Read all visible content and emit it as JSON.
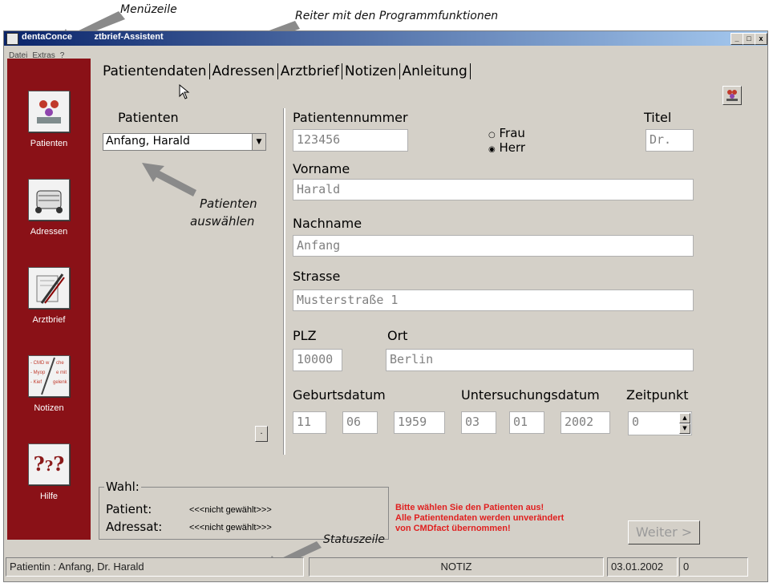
{
  "annotations": {
    "menuzeile": "Menüzeile",
    "reiter": "Reiter mit den Programmfunktionen",
    "patienten_line1": "Patienten",
    "patienten_line2": "auswählen",
    "statuszeile": "Statuszeile"
  },
  "window": {
    "title_left": "dentaConce",
    "title_right": "ztbrief-Assistent",
    "controls": [
      "_",
      "□",
      "x"
    ]
  },
  "menu": [
    "Datei",
    "Extras",
    "?"
  ],
  "sidebar": [
    {
      "label": "Patienten",
      "icon": "patients-icon"
    },
    {
      "label": "Adressen",
      "icon": "rolodex-icon"
    },
    {
      "label": "Arztbrief",
      "icon": "letter-pen-icon"
    },
    {
      "label": "Notizen",
      "icon": "notes-icon"
    },
    {
      "label": "Hilfe",
      "icon": "help-icon"
    }
  ],
  "sidebar_notes_text": [
    "- CMD w",
    "che",
    "- Myop",
    "e mit",
    "- Kief",
    "gelenk"
  ],
  "tabs": [
    "Patientendaten",
    "Adressen",
    "Arztbrief",
    "Notizen",
    "Anleitung"
  ],
  "patients": {
    "label": "Patienten",
    "selected": "Anfang, Harald"
  },
  "form": {
    "patientennummer_label": "Patientennummer",
    "patientennummer": "123456",
    "gender_frau": "Frau",
    "gender_herr": "Herr",
    "gender_selected": "Herr",
    "titel_label": "Titel",
    "titel": "Dr.",
    "vorname_label": "Vorname",
    "vorname": "Harald",
    "nachname_label": "Nachname",
    "nachname": "Anfang",
    "strasse_label": "Strasse",
    "strasse": "Musterstraße 1",
    "plz_label": "PLZ",
    "plz": "10000",
    "ort_label": "Ort",
    "ort": "Berlin",
    "geburtsdatum_label": "Geburtsdatum",
    "geb_tag": "11",
    "geb_monat": "06",
    "geb_jahr": "1959",
    "untersuchungsdatum_label": "Untersuchungsdatum",
    "unt_tag": "03",
    "unt_monat": "01",
    "unt_jahr": "2002",
    "zeitpunkt_label": "Zeitpunkt",
    "zeitpunkt": "0"
  },
  "small_button": ".",
  "wahl": {
    "legend": "Wahl:",
    "patient_label": "Patient:",
    "patient_value": "<<<nicht gewählt>>>",
    "adressat_label": "Adressat:",
    "adressat_value": "<<<nicht gewählt>>>"
  },
  "warning": {
    "line1": "Bitte wählen Sie den Patienten aus!",
    "line2": "Alle Patientendaten werden unverändert",
    "line3": "von CMDfact übernommen!"
  },
  "weiter_button": "Weiter >",
  "status": {
    "patient": "Patientin : Anfang, Dr. Harald",
    "notiz": "NOTIZ",
    "date": "03.01.2002",
    "count": "0"
  }
}
